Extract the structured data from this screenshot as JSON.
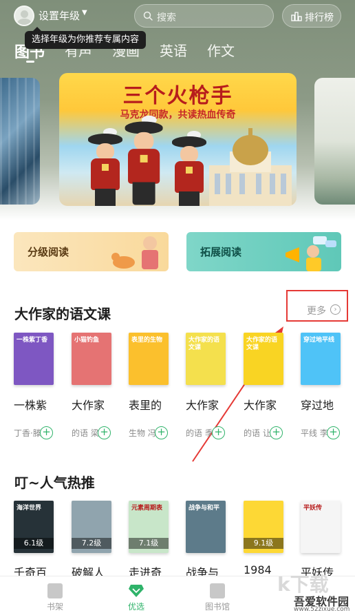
{
  "header": {
    "grade_label": "设置年级",
    "tooltip": "选择年级为你推荐专属内容",
    "search_placeholder": "搜索",
    "rank_label": "排行榜"
  },
  "tabs": [
    {
      "label": "图书",
      "active": true
    },
    {
      "label": "有声",
      "active": false
    },
    {
      "label": "漫画",
      "active": false
    },
    {
      "label": "英语",
      "active": false
    },
    {
      "label": "作文",
      "active": false
    }
  ],
  "banner": {
    "title": "三个火枪手",
    "subtitle": "马克龙同款，共读热血传奇"
  },
  "reading_cards": {
    "grade_reading": "分级阅读",
    "expand_reading": "拓展阅读"
  },
  "section_authors": {
    "title": "大作家的语文课",
    "more": "更多",
    "books": [
      {
        "title": "一株紫",
        "author": "丁香·滕…",
        "cover": "#7e57c2",
        "cover_text": "一株紫丁香",
        "level": ""
      },
      {
        "title": "大作家",
        "author": "的语 梁…",
        "cover": "#e57373",
        "cover_text": "小猫钓鱼",
        "level": ""
      },
      {
        "title": "表里的",
        "author": "生物 冯至",
        "cover": "#fbc02d",
        "cover_text": "表里的生物",
        "level": ""
      },
      {
        "title": "大作家",
        "author": "的语 季…",
        "cover": "#f4e04d",
        "cover_text": "大作家的语文课",
        "level": ""
      },
      {
        "title": "大作家",
        "author": "的语 让-…",
        "cover": "#f9d423",
        "cover_text": "大作家的语文课",
        "level": ""
      },
      {
        "title": "穿过地",
        "author": "平线 李…",
        "cover": "#4fc3f7",
        "cover_text": "穿过地平线",
        "level": ""
      }
    ]
  },
  "section_hot": {
    "title": "叮~人气热推",
    "books": [
      {
        "title": "千奇百",
        "cover": "#263238",
        "cover_text": "海洋世界",
        "level": "6.1级"
      },
      {
        "title": "破解人",
        "cover": "#90a4ae",
        "cover_text": "",
        "level": "7.2级"
      },
      {
        "title": "走进奇",
        "cover": "#c8e6c9",
        "cover_text": "元素周期表",
        "level": "7.1级"
      },
      {
        "title": "战争与",
        "cover": "#5d7b8a",
        "cover_text": "战争与和平",
        "level": ""
      },
      {
        "title": "1984",
        "cover": "#fdd835",
        "cover_text": "",
        "level": "9.1级"
      },
      {
        "title": "平妖传",
        "cover": "#f5f5f5",
        "cover_text": "平妖传",
        "level": ""
      }
    ]
  },
  "bottom_nav": [
    {
      "label": "书架",
      "active": false
    },
    {
      "label": "优选",
      "active": true
    },
    {
      "label": "图书馆",
      "active": false
    }
  ],
  "watermark": {
    "name": "吾爱软件园",
    "url": "www.52zixue.com"
  },
  "colors": {
    "accent": "#2fb36a",
    "annotation": "#e53935"
  }
}
